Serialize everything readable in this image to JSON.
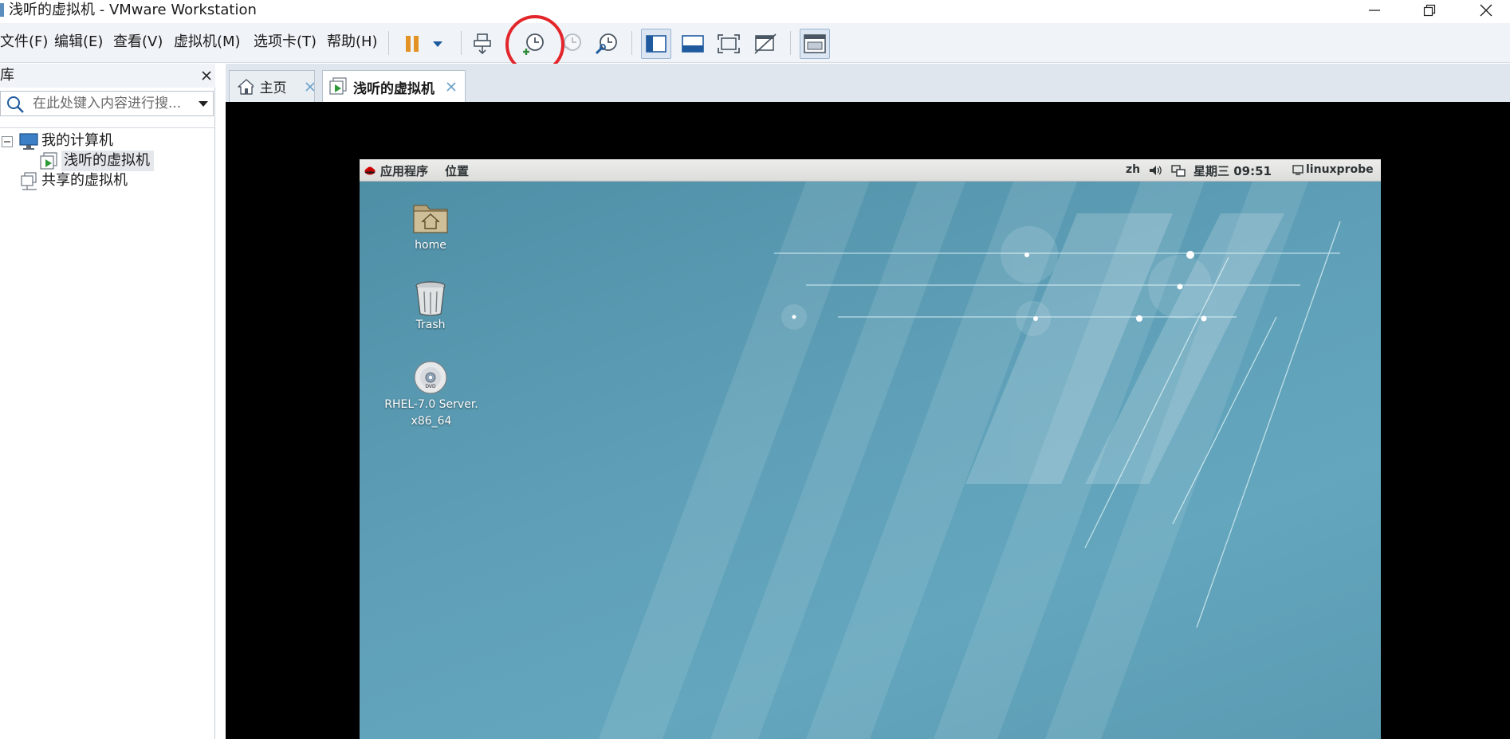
{
  "window": {
    "title": "浅听的虚拟机 - VMware Workstation",
    "controls": [
      "minimize",
      "restore",
      "close"
    ]
  },
  "menu": {
    "file": "文件(F)",
    "edit": "编辑(E)",
    "view": "查看(V)",
    "vm": "虚拟机(M)",
    "tabs": "选项卡(T)",
    "help": "帮助(H)"
  },
  "toolbar": {
    "icons": [
      "pause-icon",
      "dropdown-arrow-icon",
      "send-ctrl-alt-del-icon",
      "take-snapshot-icon",
      "revert-snapshot-icon",
      "snapshot-manager-icon",
      "show-library-icon",
      "show-thumbnail-bar-icon",
      "full-screen-icon",
      "unity-icon",
      "console-view-icon"
    ],
    "highlighted": "take-snapshot-icon",
    "highlight_color": "#e3262b"
  },
  "library": {
    "title": "库",
    "search_placeholder": "在此处键入内容进行搜...",
    "tree": {
      "my_computer": "我的计算机",
      "vm": "浅听的虚拟机",
      "shared": "共享的虚拟机"
    }
  },
  "tabs": [
    {
      "label": "主页",
      "icon": "home-icon"
    },
    {
      "label": "浅听的虚拟机",
      "icon": "vm-tab-icon",
      "selected": true
    }
  ],
  "guest": {
    "panel": {
      "applications": "应用程序",
      "places": "位置",
      "lang": "zh",
      "clock": "星期三 09:51",
      "user": "linuxprobe"
    },
    "desktop_icons": [
      {
        "label": "home",
        "icon": "home-folder-icon"
      },
      {
        "label": "Trash",
        "icon": "trash-icon"
      },
      {
        "label_line1": "RHEL-7.0 Server.",
        "label_line2": "x86_64",
        "icon": "dvd-icon"
      }
    ]
  },
  "colors": {
    "toolbar_bg": "#f0f4f8",
    "desktop": "#5fa0b8",
    "console_bg": "#000000"
  }
}
